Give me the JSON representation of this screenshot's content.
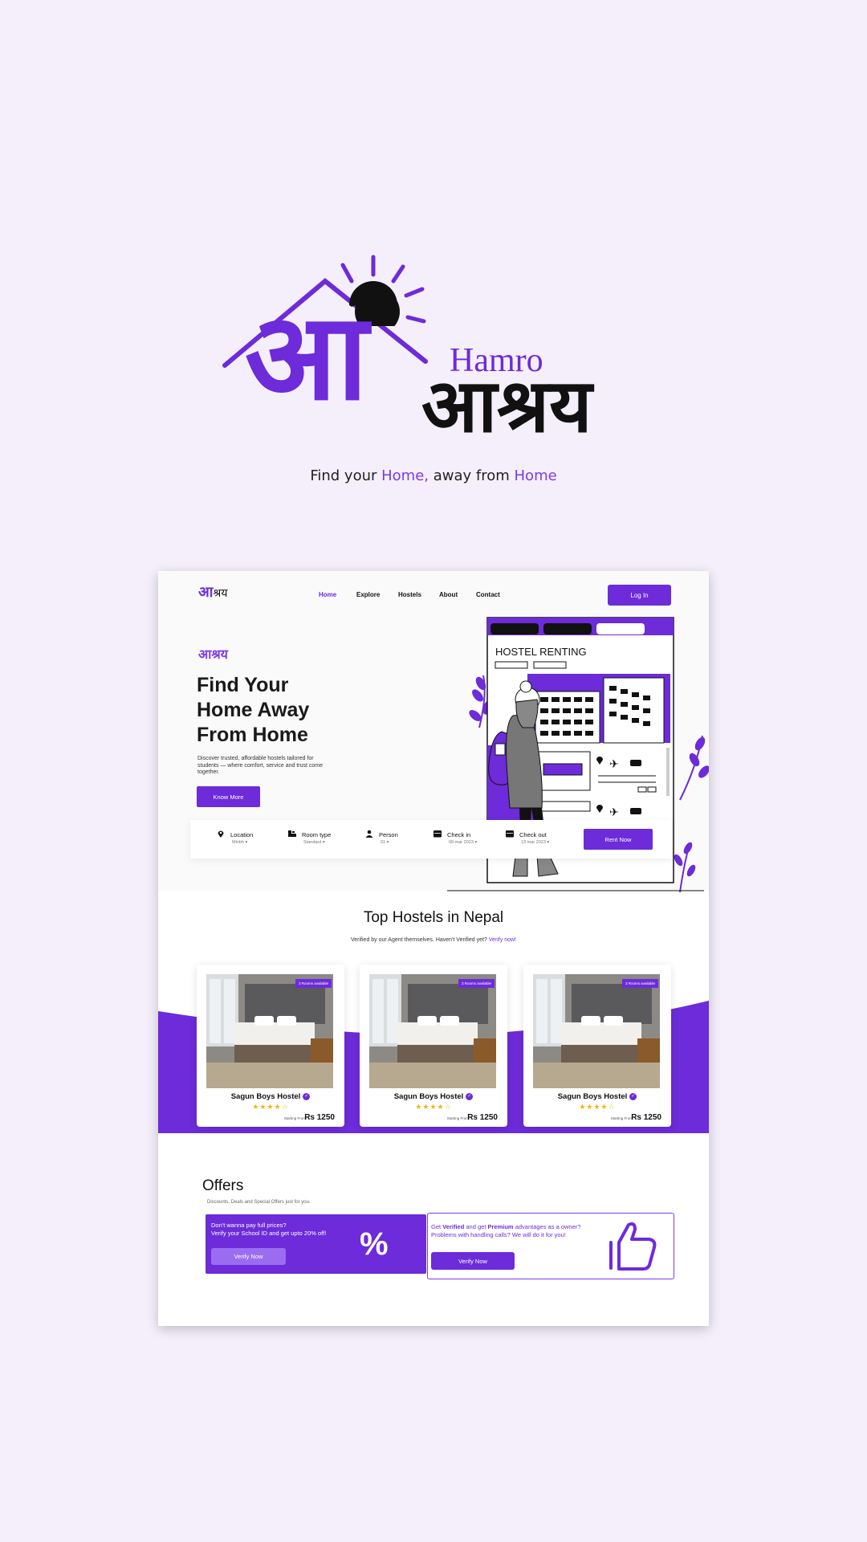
{
  "brand": {
    "logo_letter": "आ",
    "name_top": "Hamro",
    "name_main": "आश्रय",
    "tagline": {
      "part1": "Find your ",
      "hl1": "Home,",
      "part2": " away from ",
      "hl2": "Home"
    }
  },
  "site": {
    "nav": {
      "logo_letter": "आ",
      "logo_text": "श्रय",
      "items": [
        "Home",
        "Explore",
        "Hostels",
        "About",
        "Contact"
      ],
      "active": "Home",
      "login_label": "Log In"
    },
    "hero": {
      "subtitle": "आश्रय",
      "title": "Find Your Home Away From Home",
      "description": "Discover trusted, affordable hostels tailored for students — where comfort, service and trust come together.",
      "cta": "Know More",
      "illustration_sign": "HOSTEL RENTING"
    },
    "search": {
      "fields": [
        {
          "icon": "location-icon",
          "label": "Location",
          "value": "Minbh ▾"
        },
        {
          "icon": "bed-icon",
          "label": "Room type",
          "value": "Standard ▾"
        },
        {
          "icon": "person-icon",
          "label": "Person",
          "value": "01 ▾"
        },
        {
          "icon": "calendar-icon",
          "label": "Check in",
          "value": "09 mar 2023 ▾"
        },
        {
          "icon": "calendar-icon",
          "label": "Check out",
          "value": "13 mar 2023 ▾"
        }
      ],
      "button": "Rent Now"
    },
    "top_hostels": {
      "title": "Top Hostels in Nepal",
      "subtitle": "Verified by our Agent themselves. Haven't Verified yet?",
      "subtitle_link": "Verify now!",
      "cards": [
        {
          "badge": "3 Rooms available",
          "name": "Sagun Boys Hostel",
          "rating": 4.5,
          "stars": "★★★★☆",
          "price_label": "Starting From",
          "price": "Rs 1250"
        },
        {
          "badge": "3 Rooms available",
          "name": "Sagun Boys Hostel",
          "rating": 4.5,
          "stars": "★★★★☆",
          "price_label": "Starting From",
          "price": "Rs 1250"
        },
        {
          "badge": "3 Rooms available",
          "name": "Sagun Boys Hostel",
          "rating": 4.5,
          "stars": "★★★★☆",
          "price_label": "Starting From",
          "price": "Rs 1250"
        }
      ]
    },
    "offers": {
      "title": "Offers",
      "subtitle": "Discounts, Deals and Special Offers just for you.",
      "offer1": {
        "line1": "Don't wanna pay full prices?",
        "line2": "Verify your School ID and get upto 20% off!",
        "button": "Verify Now",
        "symbol": "%"
      },
      "offer2": {
        "t1": "Get ",
        "b1": "Verified",
        "t2": " and get ",
        "b2": "Premium",
        "t3": " advantages as a owner? Problems with handling calls? We will do it for you!",
        "button": "Verify Now"
      }
    },
    "colors": {
      "accent": "#6d2bd9",
      "background": "#f4effb",
      "star": "#f5b301"
    }
  }
}
